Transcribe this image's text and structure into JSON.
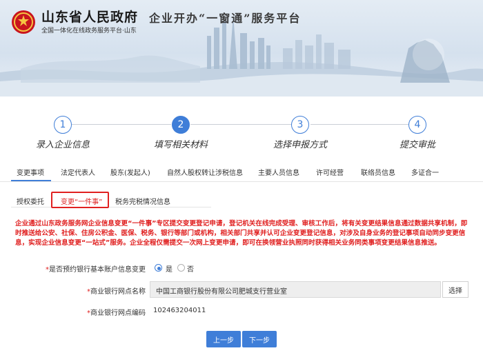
{
  "header": {
    "province": "山东省人民政府",
    "subtitle": "全国一体化在线政务服务平台·山东",
    "platform_title": "企业开办“一窗通”服务平台",
    "emblem_icon": "national-emblem-icon",
    "colors": {
      "banner": "#d5e1ee",
      "accent": "#3f7ed8",
      "alert": "#e02020"
    }
  },
  "steps": [
    {
      "num": "1",
      "label": "录入企业信息",
      "state": "done"
    },
    {
      "num": "2",
      "label": "填写相关材料",
      "state": "current"
    },
    {
      "num": "3",
      "label": "选择申报方式",
      "state": "todo"
    },
    {
      "num": "4",
      "label": "提交审批",
      "state": "todo"
    }
  ],
  "tabs": [
    "变更事项",
    "法定代表人",
    "股东(发起人)",
    "自然人股权转让涉税信息",
    "主要人员信息",
    "许可经营",
    "联络员信息",
    "多证合一"
  ],
  "subtabs": [
    "授权委托",
    "变更“一件事”",
    "税务完税情况信息"
  ],
  "notice": "企业通过山东政务服务网企业信息变更“一件事”专区提交变更登记申请，登记机关在线完成受理、审核工作后，将有关变更结果信息通过数据共享机制，即时推送给公安、社保、住房公积金、医保、税务、银行等部门或机构，相关部门共享并认可企业变更登记信息，对涉及自身业务的登记事项自动同步变更信息，实现企业信息变更“一站式”服务。企业全程仅需提交一次网上变更申请，即可在换领营业执照同时获得相关业务同类事项变更结果信息推送。",
  "form": {
    "appointment": {
      "star": "*",
      "label": "是否预约银行基本账户信息变更",
      "yes": "是",
      "no": "否",
      "selected": "yes"
    },
    "branch": {
      "star": "*",
      "label": "商业银行网点名称",
      "value": "中国工商银行股份有限公司肥城支行营业室",
      "button": "选择"
    },
    "code": {
      "star": "*",
      "label": "商业银行网点编码",
      "value": "102463204011"
    }
  },
  "buttons": {
    "prev": "上一步",
    "next": "下一步"
  }
}
